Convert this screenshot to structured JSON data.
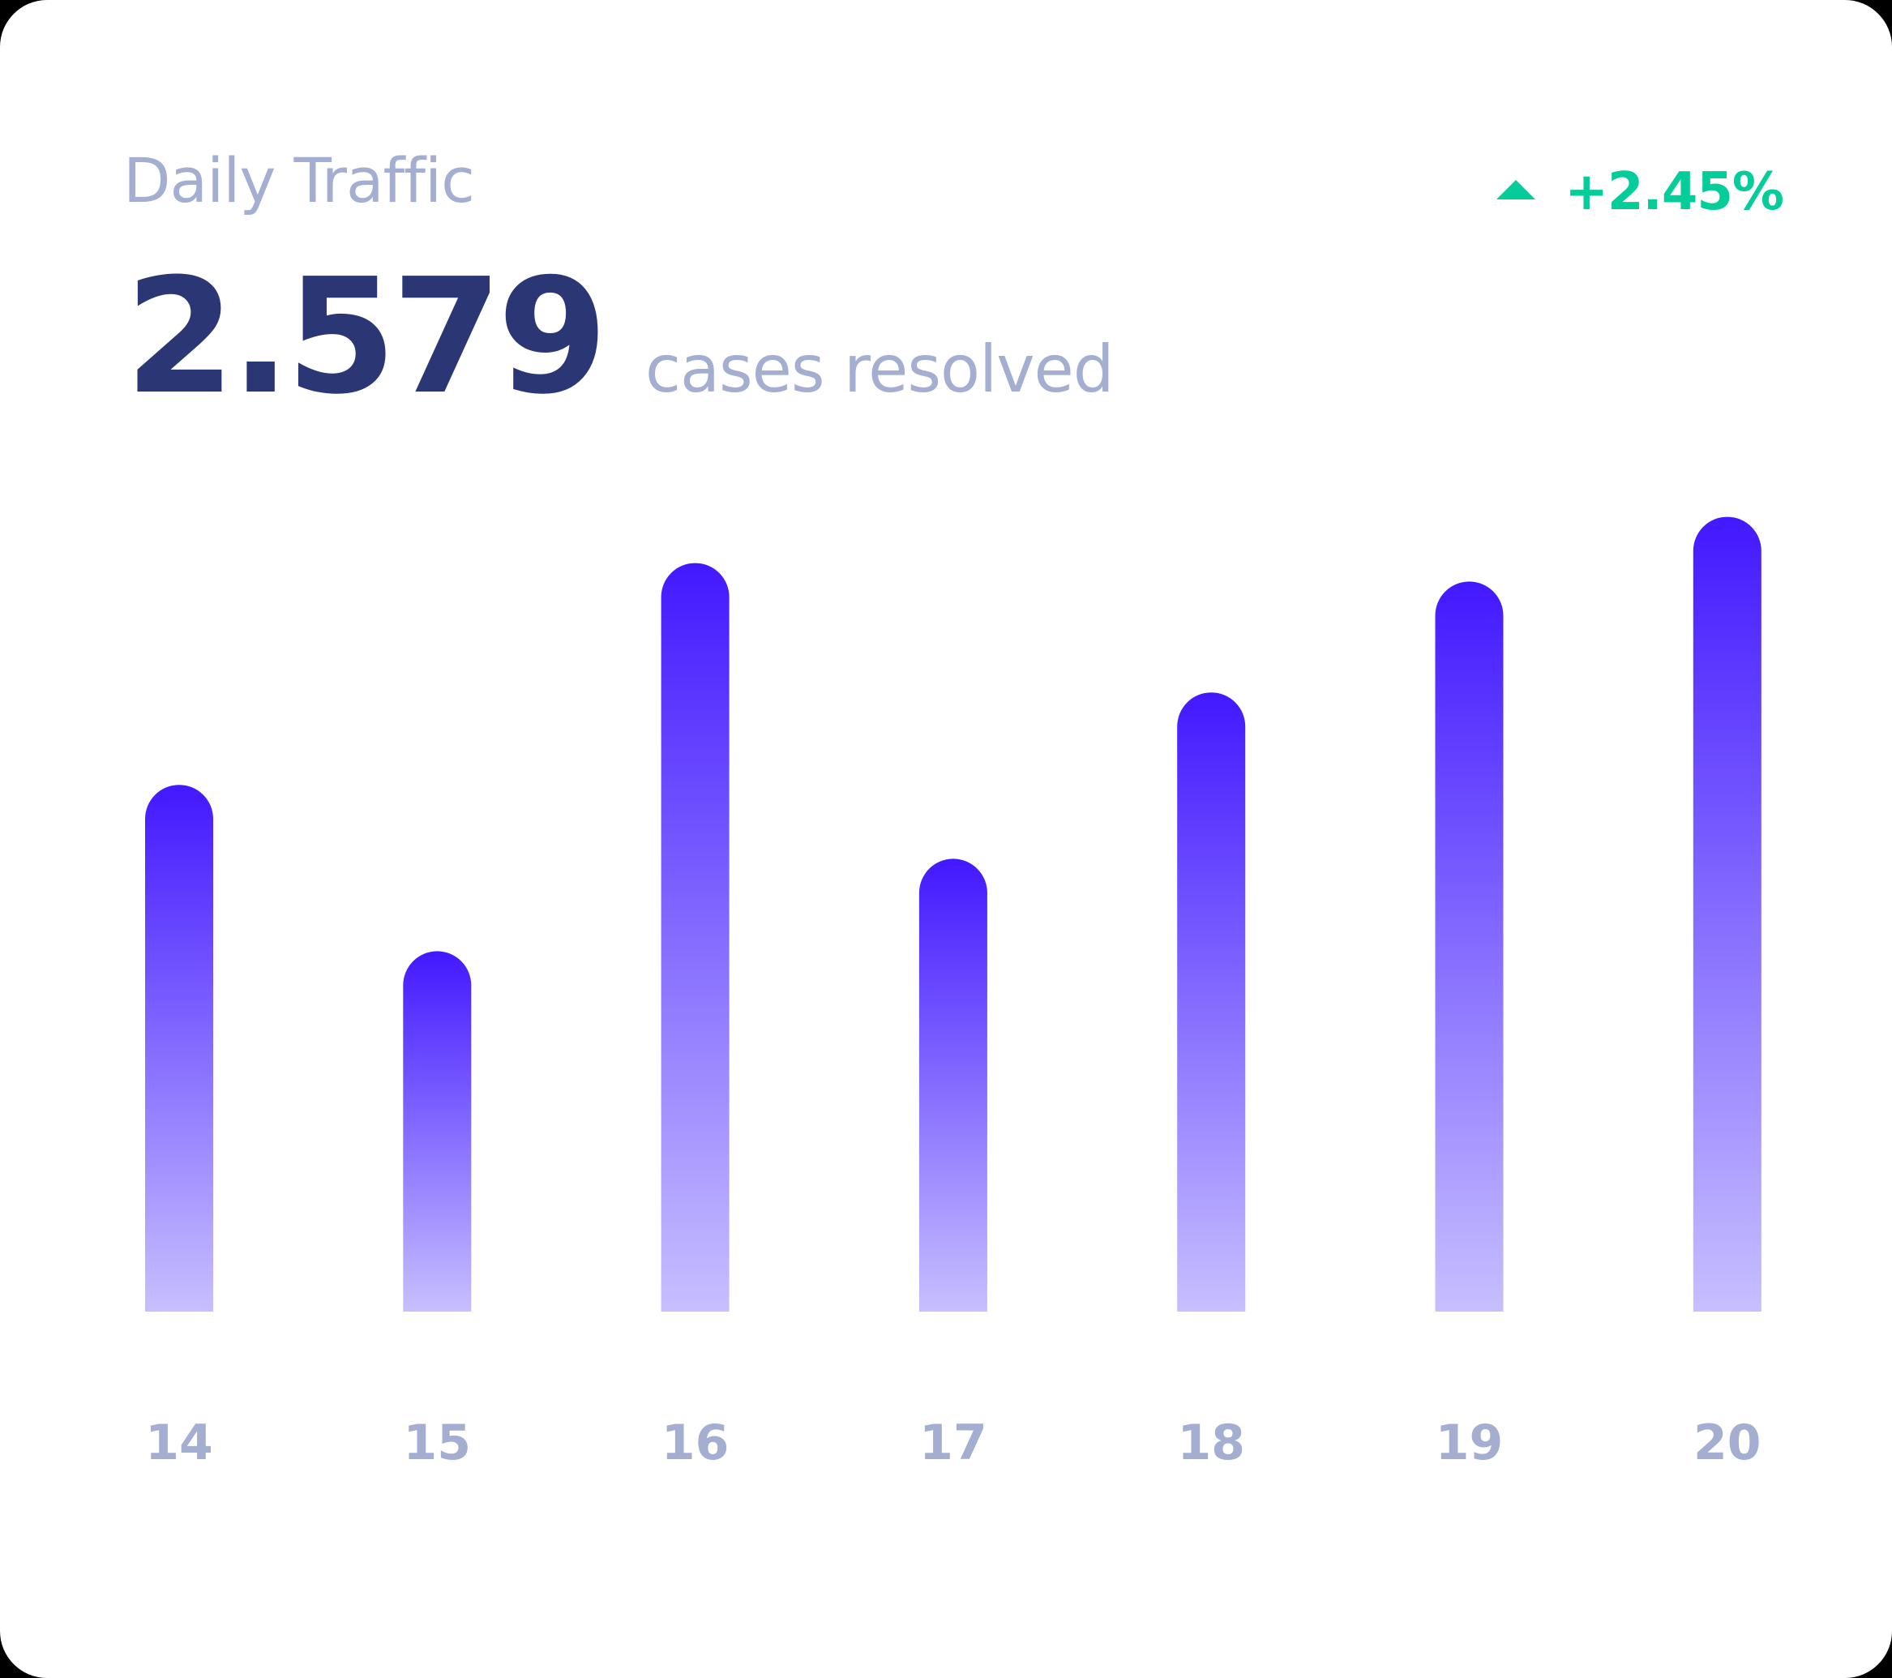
{
  "card": {
    "title": "Daily Traffic",
    "change": "+2.45%",
    "change_icon": "triangle-up-icon",
    "value": "2.579",
    "value_caption": "cases resolved"
  },
  "colors": {
    "title": "#a3aed0",
    "value": "#2b3674",
    "positive": "#05cd99",
    "bar_top": "#4318ff",
    "bar_bottom": "#c7bfff",
    "tick": "#a3aed0"
  },
  "chart_data": {
    "type": "bar",
    "title": "",
    "xlabel": "",
    "ylabel": "",
    "categories": [
      "14",
      "15",
      "16",
      "17",
      "18",
      "19",
      "20"
    ],
    "values": [
      57,
      39,
      81,
      49,
      67,
      79,
      86
    ],
    "ylim": [
      0,
      100
    ],
    "grid": false,
    "legend": "none"
  }
}
